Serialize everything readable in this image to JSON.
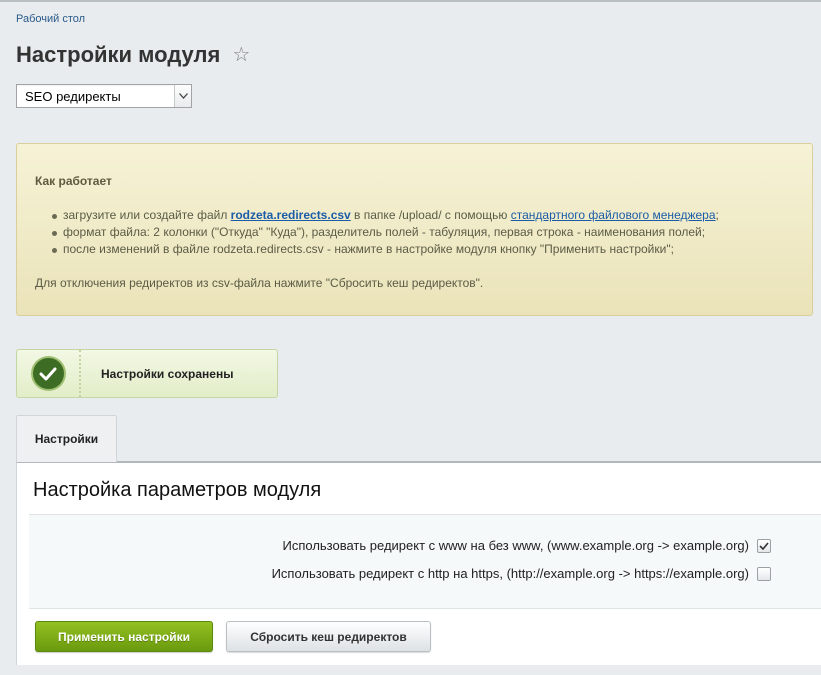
{
  "breadcrumb": {
    "label": "Рабочий стол"
  },
  "page": {
    "title": "Настройки модуля",
    "favorite_icon": "star-icon"
  },
  "module_select": {
    "selected": "SEO редиректы",
    "icon": "chevron-down-icon"
  },
  "info": {
    "heading": "Как работает",
    "items": [
      {
        "prefix": "загрузите или создайте файл ",
        "file_link": "rodzeta.redirects.csv",
        "middle": " в папке /upload/ с помощью ",
        "manager_link": "стандартного файлового менеджера",
        "suffix": ";"
      },
      {
        "text": "формат файла: 2 колонки (\"Откуда\" \"Куда\"), разделитель полей - табуляция, первая строка - наименования полей;"
      },
      {
        "text": "после изменений в файле rodzeta.redirects.csv - нажмите в настройке модуля кнопку \"Применить настройки\";"
      }
    ],
    "footer": "Для отключения редиректов из csv-файла нажмите \"Сбросить кеш редиректов\"."
  },
  "notice": {
    "text": "Настройки сохранены",
    "icon": "checkmark-icon",
    "color": "#3d6d25"
  },
  "tabs": [
    {
      "label": "Настройки",
      "active": true
    }
  ],
  "panel": {
    "title": "Настройка параметров модуля",
    "options": [
      {
        "label": "Использовать редирект с www на без www, (www.example.org -> example.org)",
        "checked": true
      },
      {
        "label": "Использовать редирект с http на https, (http://example.org -> https://example.org)",
        "checked": false
      }
    ]
  },
  "buttons": {
    "apply": "Применить настройки",
    "reset": "Сбросить кеш редиректов"
  },
  "colors": {
    "accent_green": "#7aaa14",
    "link": "#1b5ca8"
  }
}
